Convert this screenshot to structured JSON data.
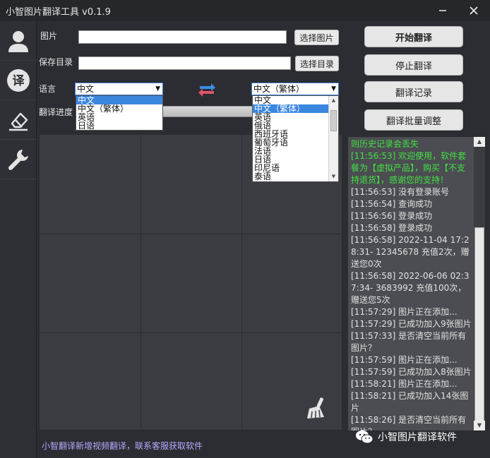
{
  "window": {
    "title": "小智图片翻译工具 v0.1.9"
  },
  "icons": {
    "minimize": "minimize-icon",
    "close": "close-icon",
    "user": "user-icon",
    "translate": "translate-icon",
    "eraser": "eraser-icon",
    "wrench": "wrench-icon",
    "swap": "swap-arrows-icon",
    "broom": "broom-icon",
    "wechat": "wechat-icon"
  },
  "nav": {
    "translate_char": "译"
  },
  "form": {
    "image_label": "图片",
    "image_value": "",
    "select_image_button": "选择图片",
    "save_dir_label": "保存目录",
    "save_dir_value": "",
    "select_dir_button": "选择目录",
    "language_label": "语言",
    "source_lang": "中文",
    "target_lang": "中文（繁体）",
    "progress_label": "翻译进度",
    "progress": 0
  },
  "source_dropdown": {
    "options": [
      "中文",
      "中文（繁体）",
      "英语",
      "日语"
    ],
    "selected_index": 0
  },
  "target_dropdown": {
    "options": [
      "中文",
      "中文（繁体）",
      "英语",
      "俄语",
      "西班牙语",
      "葡萄牙语",
      "法语",
      "日语",
      "印尼语",
      "泰语"
    ],
    "selected_index": 1
  },
  "actions": {
    "start": "开始翻译",
    "stop": "停止翻译",
    "history": "翻译记录",
    "batch_adjust": "翻译批量调整"
  },
  "log": [
    {
      "text": "则历史记录会丢失",
      "color": "green"
    },
    {
      "text": "[11:56:53] 欢迎使用，软件套餐为【虚拟产品】，购买【不支持退货】，感谢您的支持！",
      "color": "green"
    },
    {
      "text": "[11:56:53] 没有登录账号",
      "color": "normal"
    },
    {
      "text": "[11:56:54] 查询成功",
      "color": "normal"
    },
    {
      "text": "[11:56:56] 登录成功",
      "color": "normal"
    },
    {
      "text": "[11:56:58] 登录成功",
      "color": "normal"
    },
    {
      "text": "[11:56:58] 2022-11-04 17:28:31- 12345678 充值2次，赠送您0次",
      "color": "normal"
    },
    {
      "text": "[11:56:58] 2022-06-06 02:37:34- 3683992 充值100次，赠送您5次",
      "color": "normal"
    },
    {
      "text": "[11:57:29] 图片正在添加...",
      "color": "normal"
    },
    {
      "text": "[11:57:29] 已成功加入9张图片",
      "color": "normal"
    },
    {
      "text": "[11:57:33] 是否清空当前所有图片？",
      "color": "normal"
    },
    {
      "text": "[11:57:59] 图片正在添加...",
      "color": "normal"
    },
    {
      "text": "[11:57:59] 已成功加入8张图片",
      "color": "normal"
    },
    {
      "text": "[11:58:21] 图片正在添加...",
      "color": "normal"
    },
    {
      "text": "[11:58:21] 已成功加入14张图片",
      "color": "normal"
    },
    {
      "text": "[11:58:26] 是否清空当前所有图片？",
      "color": "normal"
    }
  ],
  "footer": {
    "notice": "小智翻译新增视频翻译，联系客服获取软件"
  },
  "watermark": {
    "text": "小智图片翻译软件"
  },
  "colors": {
    "log_green": "#43e043",
    "selection": "#3a87e0",
    "footer": "#b8a8ff"
  }
}
